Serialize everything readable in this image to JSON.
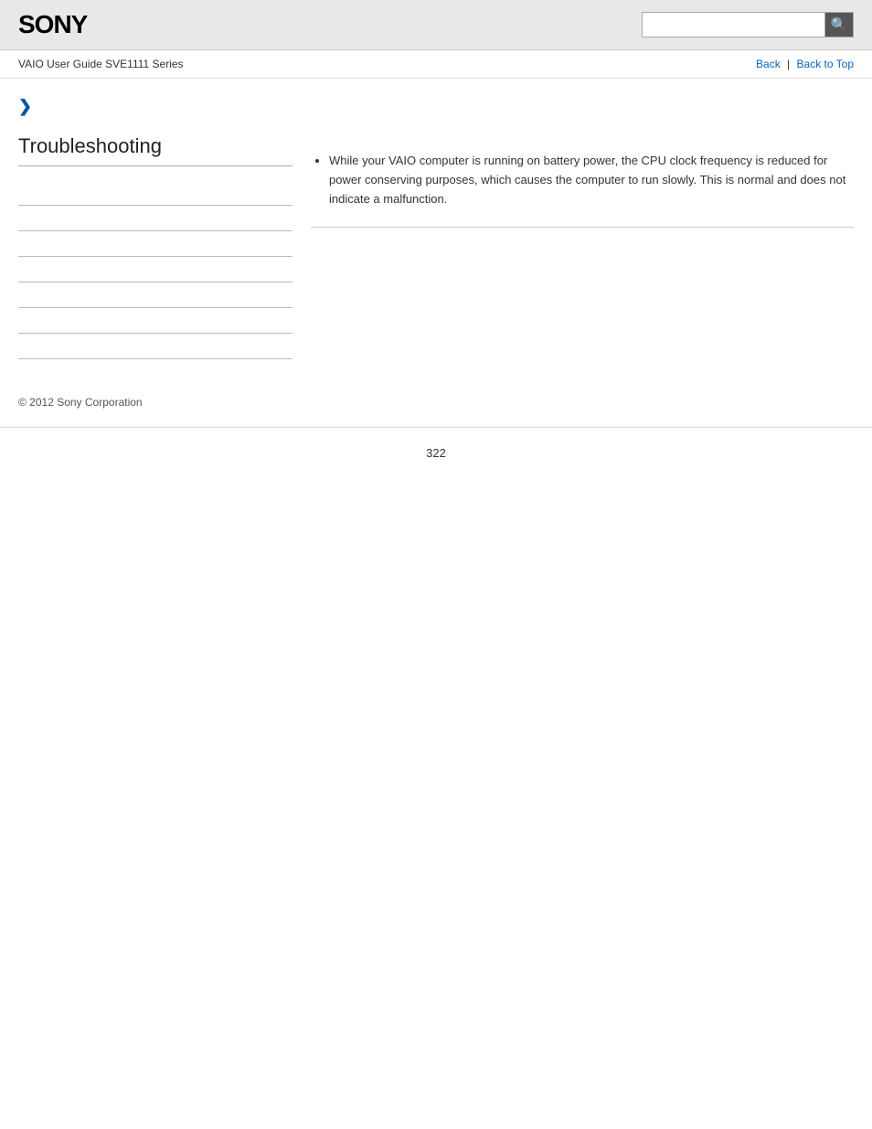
{
  "header": {
    "logo": "SONY",
    "search_placeholder": "",
    "search_button_icon": "🔍"
  },
  "navbar": {
    "guide_title": "VAIO User Guide SVE1111 Series",
    "back_label": "Back",
    "back_to_top_label": "Back to Top",
    "separator": "|"
  },
  "sidebar": {
    "chevron": "❯",
    "heading": "Troubleshooting",
    "links": [
      {
        "label": ""
      },
      {
        "label": ""
      },
      {
        "label": ""
      },
      {
        "label": ""
      },
      {
        "label": ""
      },
      {
        "label": ""
      },
      {
        "label": ""
      }
    ]
  },
  "content": {
    "bullet_text": "While your VAIO computer is running on battery power, the CPU clock frequency is reduced for power conserving purposes, which causes the computer to run slowly. This is normal and does not indicate a malfunction."
  },
  "footer": {
    "copyright": "© 2012 Sony Corporation"
  },
  "page_number": "322"
}
